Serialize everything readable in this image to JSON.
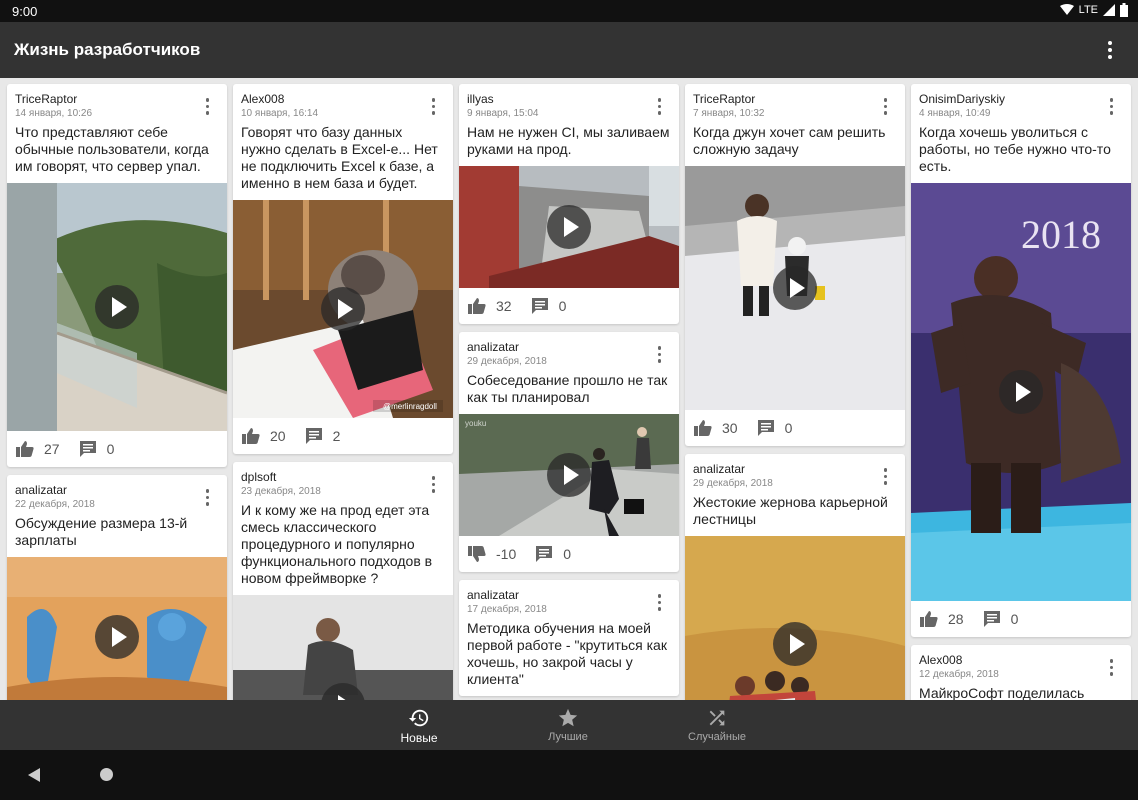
{
  "status": {
    "time": "9:00",
    "network": "LTE"
  },
  "app": {
    "title": "Жизнь разработчиков"
  },
  "feed": {
    "col1": [
      {
        "author": "TriceRaptor",
        "date": "14 января, 10:26",
        "text": "Что представляют себе обычные пользователи, когда им говорят, что сервер упал.",
        "likes": "27",
        "comments": "0"
      },
      {
        "author": "analizatar",
        "date": "22 декабря, 2018",
        "text": "Обсуждение размера 13-й зарплаты"
      }
    ],
    "col2": [
      {
        "author": "Alex008",
        "date": "10 января, 16:14",
        "text": "Говорят что базу данных нужно сделать в Excel-е... Нет не подключить Excel к базе, а именно в нем база и будет.",
        "watermark": "@merlinragdoll",
        "likes": "20",
        "comments": "2"
      },
      {
        "author": "dplsoft",
        "date": "23 декабря, 2018",
        "text": "И к кому же на прод едет эта смесь классического процедурного и популярно функционального подходов в новом фреймворке ?"
      }
    ],
    "col3": [
      {
        "author": "illyas",
        "date": "9 января, 15:04",
        "text": "Нам не нужен CI, мы заливаем руками на прод.",
        "likes": "32",
        "comments": "0"
      },
      {
        "author": "analizatar",
        "date": "29 декабря, 2018",
        "text": "Собеседование прошло не так как ты планировал",
        "watermark": "youku",
        "likes": "-10",
        "comments": "0"
      },
      {
        "author": "analizatar",
        "date": "17 декабря, 2018",
        "text": "Методика обучения на моей первой работе - \"крутиться как хочешь, но закрой часы у клиента\""
      }
    ],
    "col4": [
      {
        "author": "TriceRaptor",
        "date": "7 января, 10:32",
        "text": "Когда джун хочет сам решить сложную задачу",
        "likes": "30",
        "comments": "0"
      },
      {
        "author": "analizatar",
        "date": "29 декабря, 2018",
        "text": "Жестокие жернова карьерной лестницы"
      }
    ],
    "col5": [
      {
        "author": "OnisimDariyskiy",
        "date": "4 января, 10:49",
        "text": "Когда хочешь уволиться с работы, но тебе нужно что-то есть.",
        "banner": "2018",
        "likes": "28",
        "comments": "0"
      },
      {
        "author": "Alex008",
        "date": "12 декабря, 2018",
        "text": "МайкроСофт поделилась"
      }
    ]
  },
  "nav": {
    "new_label": "Новые",
    "best_label": "Лучшие",
    "random_label": "Случайные"
  },
  "colors": {
    "appbar": "#333333",
    "statusbar": "#111111",
    "background": "#e8e8e8",
    "card": "#ffffff"
  }
}
